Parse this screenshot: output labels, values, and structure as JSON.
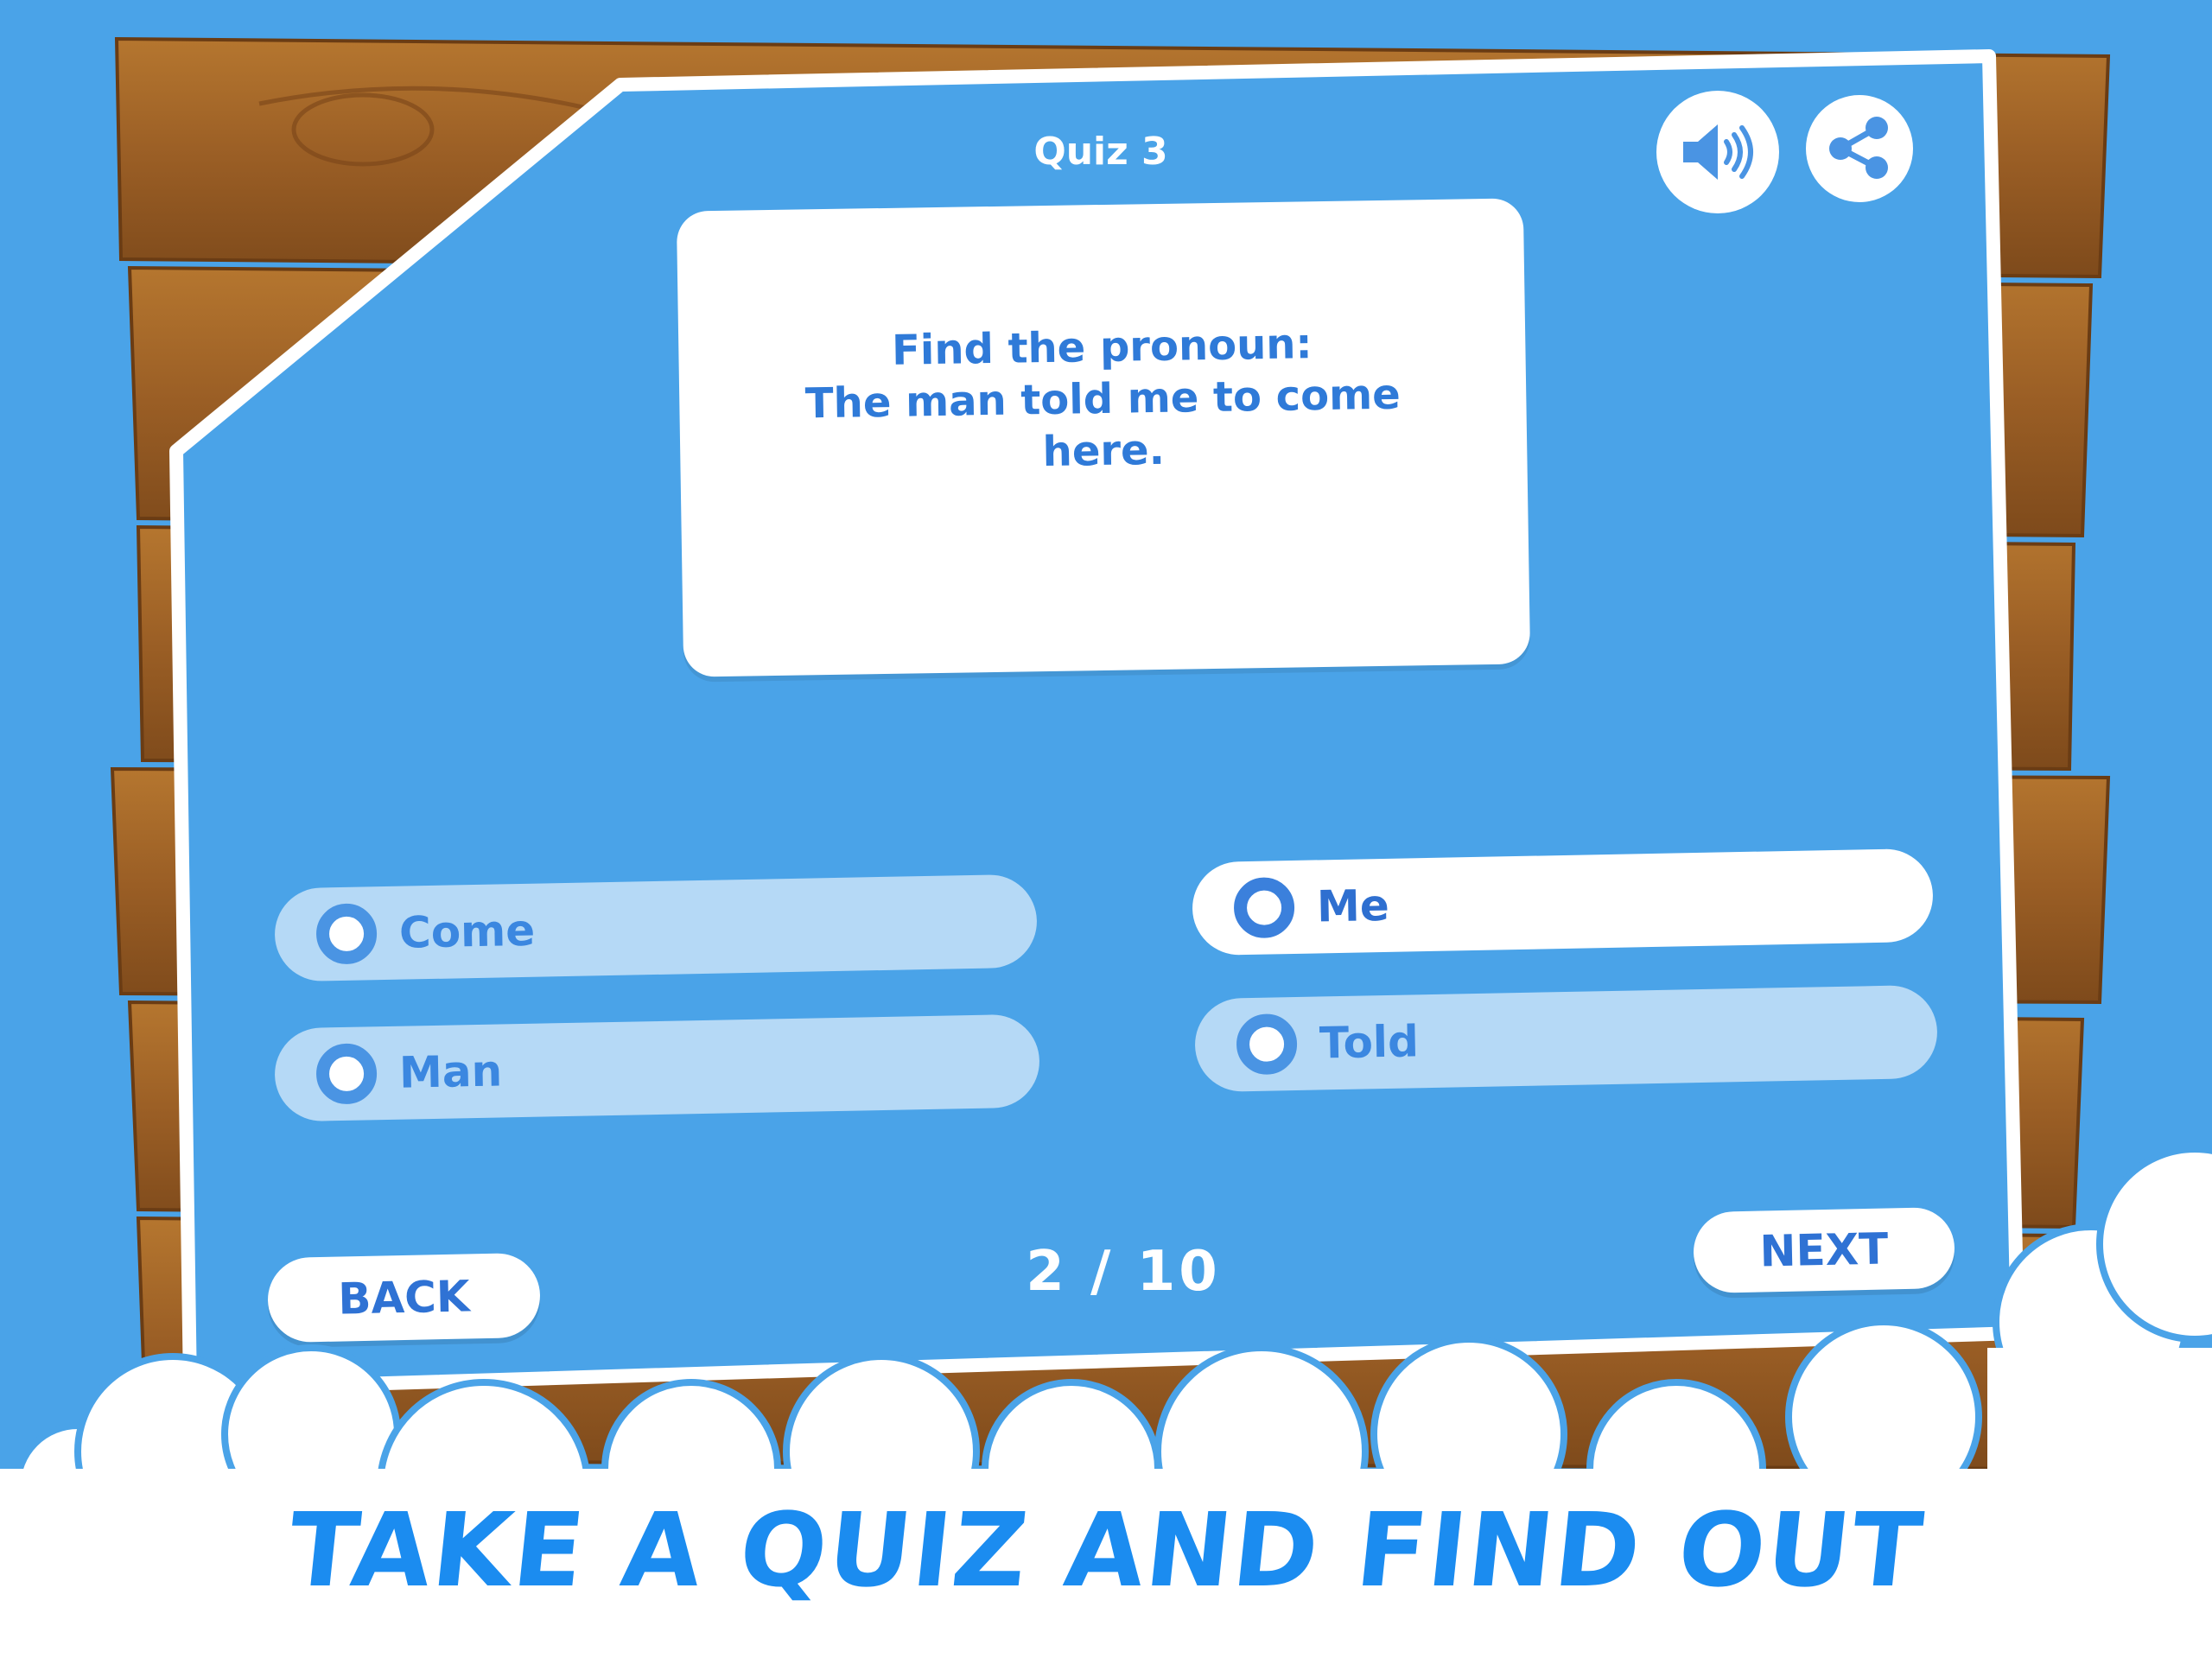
{
  "quiz": {
    "title": "Quiz 3",
    "question_line1": "Find the pronoun:",
    "question_line2": "The man told me to come here.",
    "options": [
      {
        "label": "Come",
        "selected": false
      },
      {
        "label": "Me",
        "selected": true
      },
      {
        "label": "Man",
        "selected": false
      },
      {
        "label": "Told",
        "selected": false
      }
    ],
    "progress": "2 / 10",
    "current": 2,
    "total": 10
  },
  "toolbar": {
    "sound_icon": "speaker-icon",
    "share_icon": "share-icon"
  },
  "nav": {
    "back_label": "BACK",
    "next_label": "NEXT"
  },
  "tagline": "TAKE A QUIZ AND FIND OUT",
  "colors": {
    "background": "#4aa3e8",
    "panel": "#4aa3e8",
    "accent_text": "#2f7ad8",
    "option_bg": "#b5d9f6",
    "tagline": "#1b8cf0",
    "wood": "#a8692a"
  }
}
